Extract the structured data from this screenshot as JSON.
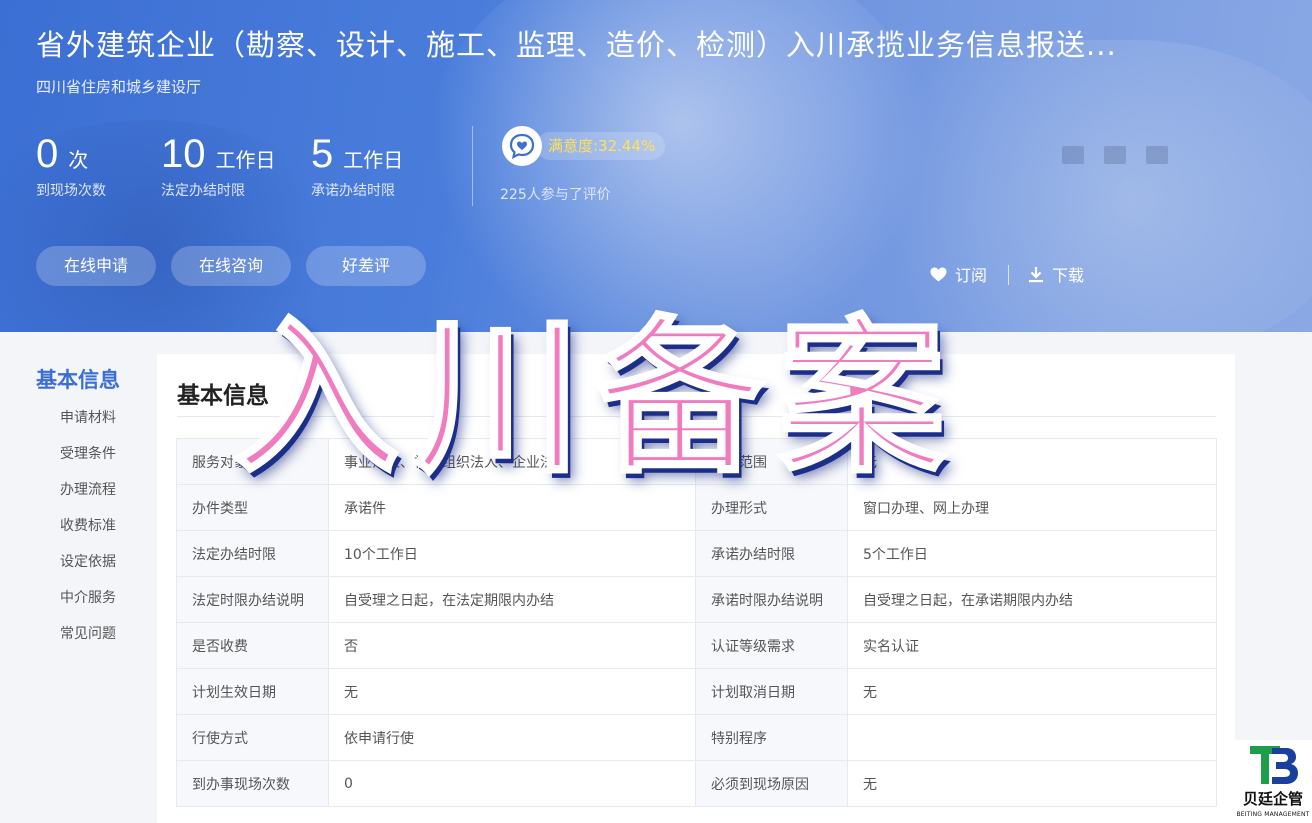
{
  "header": {
    "title": "省外建筑企业（勘察、设计、施工、监理、造价、检测）入川承揽业务信息报送...",
    "department": "四川省住房和城乡建设厅"
  },
  "stats": [
    {
      "value": "0",
      "unit": "次",
      "label": "到现场次数"
    },
    {
      "value": "10",
      "unit": "工作日",
      "label": "法定办结时限"
    },
    {
      "value": "5",
      "unit": "工作日",
      "label": "承诺办结时限"
    }
  ],
  "satisfaction": {
    "label": "满意度:32.44%",
    "participants": "225人参与了评价"
  },
  "actions": {
    "apply": "在线申请",
    "consult": "在线咨询",
    "rate": "好差评",
    "subscribe": "订阅",
    "download": "下载"
  },
  "nav": {
    "title": "基本信息",
    "items": [
      "申请材料",
      "受理条件",
      "办理流程",
      "收费标准",
      "设定依据",
      "中介服务",
      "常见问题"
    ]
  },
  "section": {
    "title": "基本信息"
  },
  "table": {
    "rows": [
      [
        "服务对象",
        "事业法人、社会组织法人、企业法人",
        "通办范围",
        "无"
      ],
      [
        "办件类型",
        "承诺件",
        "办理形式",
        "窗口办理、网上办理"
      ],
      [
        "法定办结时限",
        "10个工作日",
        "承诺办结时限",
        "5个工作日"
      ],
      [
        "法定时限办结说明",
        "自受理之日起，在法定期限内办结",
        "承诺时限办结说明",
        "自受理之日起，在承诺期限内办结"
      ],
      [
        "是否收费",
        "否",
        "认证等级需求",
        "实名认证"
      ],
      [
        "计划生效日期",
        "无",
        "计划取消日期",
        "无"
      ],
      [
        "行使方式",
        "依申请行使",
        "特别程序",
        ""
      ],
      [
        "到办事现场次数",
        "0",
        "必须到现场原因",
        "无"
      ]
    ]
  },
  "watermark": {
    "text": "入川备案"
  },
  "logo": {
    "cn": "贝廷企管",
    "en": "BEITING MANAGEMENT"
  },
  "colors": {
    "accent": "#3b6fd4",
    "satisfaction": "#ffe15a",
    "watermark": "#f07bbf"
  }
}
